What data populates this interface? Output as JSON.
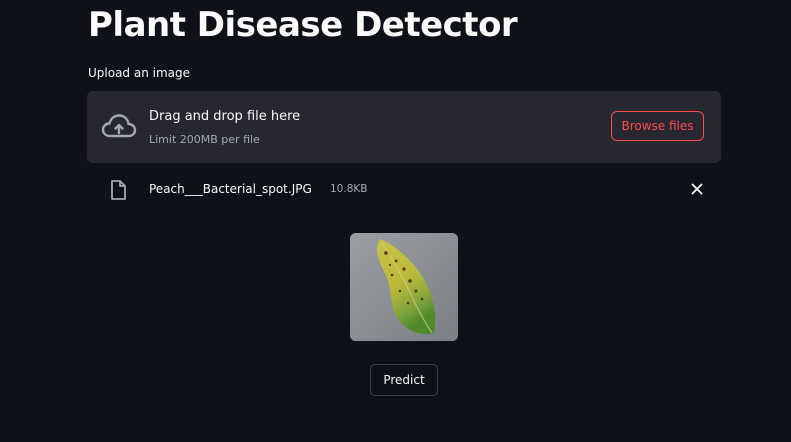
{
  "page": {
    "title": "Plant Disease Detector"
  },
  "uploader": {
    "label": "Upload an image",
    "drop_text": "Drag and drop file here",
    "limit_text": "Limit 200MB per file",
    "browse_label": "Browse files",
    "icon": "cloud-upload-icon"
  },
  "uploaded_file": {
    "name": "Peach___Bacterial_spot.JPG",
    "size": "10.8KB",
    "icon": "file-icon",
    "remove_icon": "close-icon"
  },
  "actions": {
    "predict_label": "Predict"
  },
  "colors": {
    "background": "#0e1117",
    "dropzone": "#262730",
    "accent": "#ff4b4b",
    "muted_text": "#a3a8b4"
  }
}
